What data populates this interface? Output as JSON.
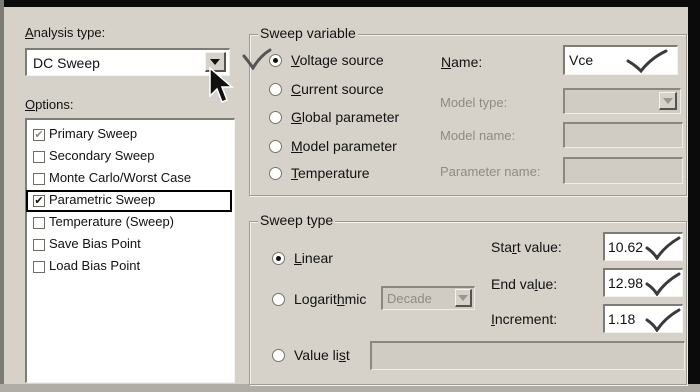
{
  "analysis": {
    "label_prefix": "A",
    "label_rest": "nalysis type:",
    "value": "DC Sweep"
  },
  "options": {
    "label_prefix": "O",
    "label_rest": "ptions:",
    "items": [
      {
        "label": "Primary Sweep",
        "checked": true,
        "grayed": true
      },
      {
        "label": "Secondary Sweep",
        "checked": false
      },
      {
        "label": "Monte Carlo/Worst Case",
        "checked": false
      },
      {
        "label": "Parametric Sweep",
        "checked": true,
        "highlight": true
      },
      {
        "label": "Temperature (Sweep)",
        "checked": false
      },
      {
        "label": "Save Bias Point",
        "checked": false
      },
      {
        "label": "Load Bias Point",
        "checked": false
      }
    ]
  },
  "sweep_variable": {
    "legend": "Sweep variable",
    "radios": [
      {
        "u": "V",
        "rest": "oltage source",
        "selected": true
      },
      {
        "u": "C",
        "rest": "urrent source",
        "selected": false
      },
      {
        "u": "G",
        "rest": "lobal parameter",
        "selected": false
      },
      {
        "u": "M",
        "rest": "odel parameter",
        "selected": false
      },
      {
        "u": "T",
        "rest": "emperature",
        "selected": false
      }
    ],
    "name_label_u": "N",
    "name_label_rest": "ame:",
    "name_value": "Vce",
    "model_type_label": "Model type:",
    "model_name_label": "Model name:",
    "parameter_name_label": "Parameter name:"
  },
  "sweep_type": {
    "legend": "Sweep type",
    "linear_u": "L",
    "linear_rest": "inear",
    "log_pre": "Logarit",
    "log_u": "h",
    "log_post": "mic",
    "log_option": "Decade",
    "value_list_pre": "Value li",
    "value_list_u": "s",
    "value_list_post": "t",
    "start_label_pre": "Sta",
    "start_label_u": "r",
    "start_label_post": "t value:",
    "start_value": "10.62",
    "end_label_pre": "End va",
    "end_label_u": "l",
    "end_label_post": "ue:",
    "end_value": "12.98",
    "inc_label_pre": "",
    "inc_label_u": "I",
    "inc_label_post": "ncrement:",
    "inc_value": "1.18"
  },
  "colors": {
    "dialog_bg": "#d6d2ca",
    "field_bg": "#ffffff",
    "highlight_border": "#000000"
  },
  "icons": [
    "checkmark-icon",
    "mouse-cursor-icon",
    "chevron-down-icon"
  ]
}
